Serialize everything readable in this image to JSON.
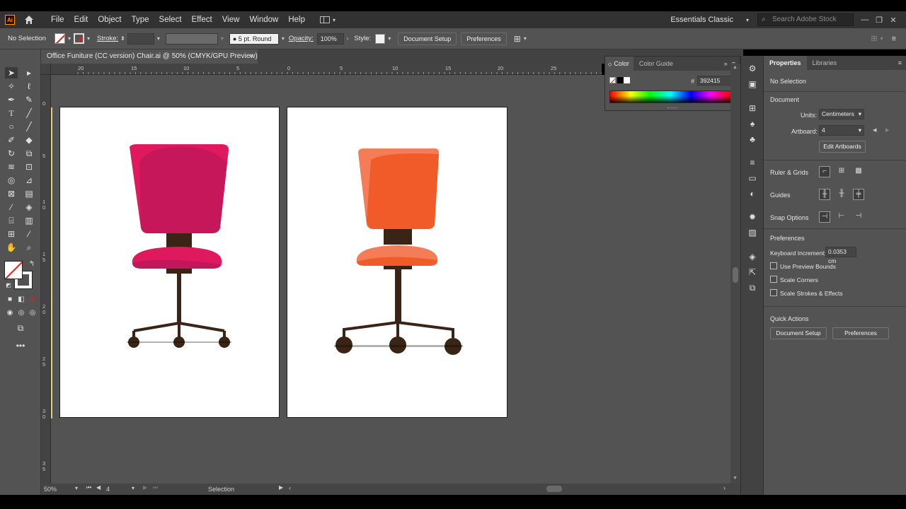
{
  "menubar": {
    "app_logo": "Ai",
    "menus": [
      "File",
      "Edit",
      "Object",
      "Type",
      "Select",
      "Effect",
      "View",
      "Window",
      "Help"
    ],
    "workspace": "Essentials Classic",
    "search_placeholder": "Search Adobe Stock"
  },
  "controlbar": {
    "selection": "No Selection",
    "stroke_label": "Stroke:",
    "brush": "5 pt. Round",
    "opacity_label": "Opacity:",
    "opacity_value": "100%",
    "style_label": "Style:",
    "document_setup": "Document Setup",
    "preferences": "Preferences"
  },
  "document": {
    "tab_title": "Office Funiture (CC version) Chair.ai @ 50% (CMYK/GPU Preview)",
    "close": "×"
  },
  "rulers": {
    "h_ticks": [
      "20",
      "15",
      "10",
      "5",
      "0",
      "5",
      "10",
      "15",
      "20",
      "25"
    ],
    "v_ticks": [
      "0",
      "5",
      "1\n0",
      "1\n5",
      "2\n0",
      "2\n5",
      "3\n0",
      "3\n5"
    ]
  },
  "statusbar": {
    "zoom": "50%",
    "artboard": "4",
    "tool": "Selection"
  },
  "color_panel": {
    "tab_color": "Color",
    "tab_color_guide": "Color Guide",
    "hex_label": "#",
    "hex_value": "392415"
  },
  "properties": {
    "tab_properties": "Properties",
    "tab_libraries": "Libraries",
    "selection": "No Selection",
    "document_heading": "Document",
    "units_label": "Units:",
    "units_value": "Centimeters",
    "artboard_label": "Artboard:",
    "artboard_value": "4",
    "edit_artboards": "Edit Artboards",
    "ruler_grids": "Ruler & Grids",
    "guides": "Guides",
    "snap_options": "Snap Options",
    "preferences_heading": "Preferences",
    "keyboard_increment_label": "Keyboard Increment:",
    "keyboard_increment_value": "0.0353 cm",
    "use_preview_bounds": "Use Preview Bounds",
    "scale_corners": "Scale Corners",
    "scale_strokes": "Scale Strokes & Effects",
    "quick_actions": "Quick Actions",
    "qa_document_setup": "Document Setup",
    "qa_preferences": "Preferences"
  },
  "colors": {
    "chair1_seat": "#c2185b",
    "chair1_highlight": "#e0195e",
    "chair2_seat": "#f15a29",
    "chair2_highlight": "#f47c57",
    "frame": "#392415"
  }
}
